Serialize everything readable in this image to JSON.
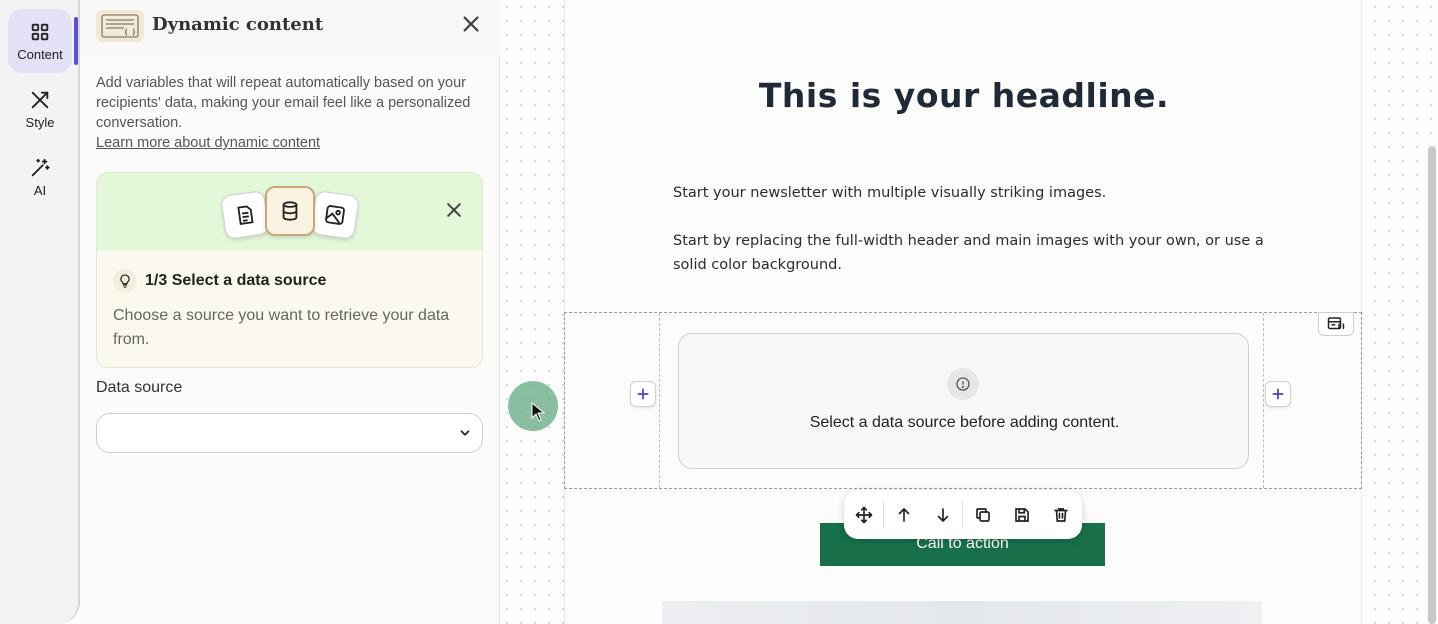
{
  "rail": {
    "items": [
      {
        "label": "Content",
        "icon": "grid-icon",
        "active": true
      },
      {
        "label": "Style",
        "icon": "brush-icon",
        "active": false
      },
      {
        "label": "AI",
        "icon": "magic-wand-icon",
        "active": false
      }
    ]
  },
  "panel": {
    "title": "Dynamic content",
    "description": "Add variables that will repeat automatically based on your recipients' data, making your email feel like a personalized conversation.",
    "learn_more": "Learn more about dynamic content",
    "step": {
      "title": "1/3 Select a data source",
      "description": "Choose a source you want to retrieve your data from."
    },
    "data_source": {
      "label": "Data source",
      "value": ""
    }
  },
  "email": {
    "headline": "This is your headline.",
    "paragraph1": "Start your newsletter with multiple visually striking images.",
    "paragraph2": "Start by replacing the full-width header and main images with your own, or use a solid color background.",
    "dynamic_block_message": "Select a data source before adding content.",
    "cta_label": "Call to action"
  },
  "toolbar": {
    "actions": [
      "move",
      "move-up",
      "move-down",
      "duplicate",
      "save",
      "delete"
    ]
  },
  "colors": {
    "accent": "#5b4fd6",
    "cta": "#17704a",
    "card_top": "#e3f7d9"
  }
}
